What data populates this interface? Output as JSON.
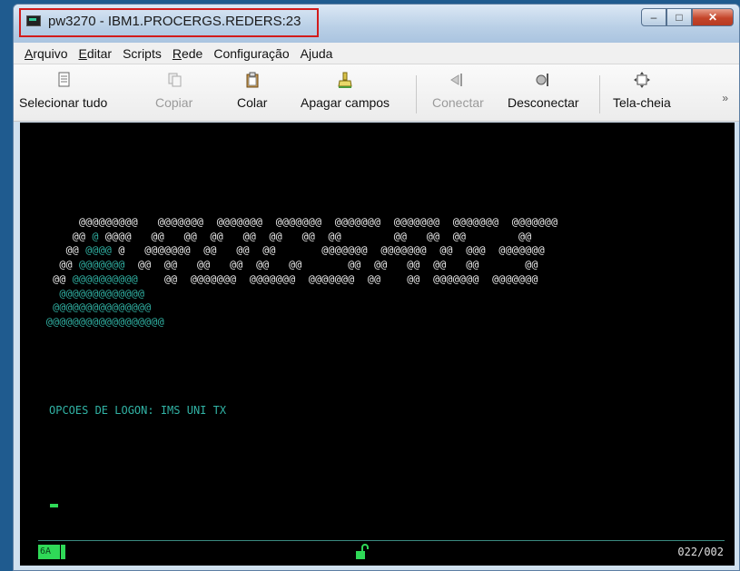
{
  "window": {
    "title": "pw3270 - IBM1.PROCERGS.REDERS:23",
    "controls": {
      "minimize": "–",
      "maximize": "□",
      "close": "✕"
    }
  },
  "menu": [
    {
      "underline": "A",
      "rest": "rquivo"
    },
    {
      "underline": "E",
      "rest": "ditar"
    },
    {
      "underline": "",
      "rest": "Scripts"
    },
    {
      "underline": "R",
      "rest": "ede"
    },
    {
      "underline": "",
      "rest": "Configuração"
    },
    {
      "underline": "",
      "rest": "Ajuda"
    }
  ],
  "toolbar": {
    "select_all": "Selecionar tudo",
    "copy": "Copiar",
    "paste": "Colar",
    "clear_fields": "Apagar campos",
    "connect": "Conectar",
    "disconnect": "Desconectar",
    "fullscreen": "Tela-cheia",
    "more": "»"
  },
  "terminal": {
    "banner": [
      {
        "left": "         ",
        "teal": "",
        "right": "@@@@@@@@@   @@@@@@@  @@@@@@@  @@@@@@@  @@@@@@@  @@@@@@@  @@@@@@@  @@@@@@@"
      },
      {
        "left": "        @@ ",
        "teal": "@",
        "right": " @@@@   @@   @@  @@   @@  @@   @@  @@        @@   @@  @@        @@"
      },
      {
        "left": "       @@ ",
        "teal": "@@@@",
        "right": " @   @@@@@@@  @@   @@  @@       @@@@@@@  @@@@@@@  @@  @@@  @@@@@@@"
      },
      {
        "left": "      @@ ",
        "teal": "@@@@@@@",
        "right": "  @@  @@   @@   @@  @@   @@       @@  @@   @@  @@   @@       @@"
      },
      {
        "left": "     @@ ",
        "teal": "@@@@@@@@@@",
        "right": "    @@  @@@@@@@  @@@@@@@  @@@@@@@  @@    @@  @@@@@@@  @@@@@@@"
      },
      {
        "left": "      ",
        "teal": "@@@@@@@@@@@@@",
        "right": ""
      },
      {
        "left": "     ",
        "teal": "@@@@@@@@@@@@@@@",
        "right": ""
      },
      {
        "left": "    ",
        "teal": "@@@@@@@@@@@@@@@@@@",
        "right": ""
      }
    ],
    "logon_prompt": "OPCOES DE LOGON: IMS UNI TX"
  },
  "status": {
    "badge": "6A",
    "cursor_position": "022/002"
  },
  "colors": {
    "terminal_bg": "#000000",
    "terminal_teal": "#31b3a5",
    "terminal_green": "#2fd957",
    "title_highlight": "#d21b1b"
  }
}
